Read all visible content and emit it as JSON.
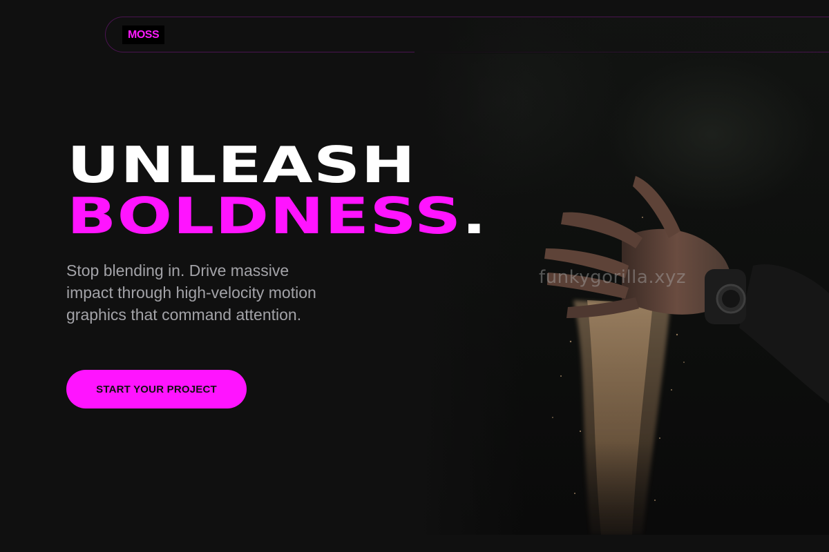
{
  "nav": {
    "logo": "MOSS"
  },
  "hero": {
    "headline_line1": "UNLEASH",
    "headline_line2": "BOLDNESS",
    "headline_period": ".",
    "subtitle": "Stop blending in. Drive massive impact through high-velocity motion graphics that command attention.",
    "cta_label": "START YOUR PROJECT",
    "watermark": "funkygorilla.xyz"
  },
  "theme": {
    "background": "#101010",
    "accent": "#ff14ff",
    "headline_primary": "#ffffff",
    "subtitle_color": "#a3a3a8"
  },
  "icons": {
    "hero_image": "hand-releasing-sand-photo"
  }
}
